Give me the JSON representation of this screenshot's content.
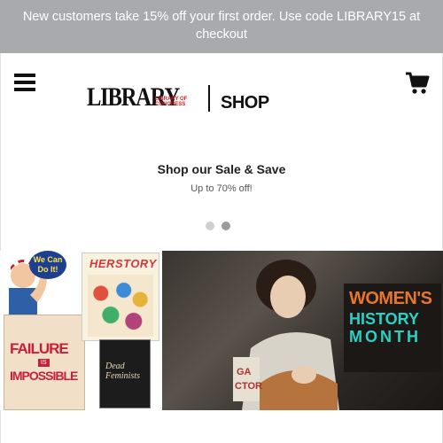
{
  "promo": {
    "text": "New customers take 15% off your first order. Use code LIBRARY15 at checkout"
  },
  "header": {
    "logo_library": "LIBRARY",
    "logo_loc": "LIBRARY OF CONGRESS",
    "logo_shop": "SHOP",
    "menu_icon": "hamburger-menu-icon",
    "cart_icon": "shopping-cart-icon"
  },
  "carousel": {
    "title": "Shop our Sale & Save",
    "subtitle": "Up to 70% off!",
    "slides": 2,
    "active_slide": 2
  },
  "banner": {
    "poster_failure_line1": "FAILURE",
    "poster_failure_line2": "IS",
    "poster_failure_line3": "IMPOSSIBLE",
    "poster_we_can": "We Can Do It!",
    "book_herstory": "HERSTORY",
    "book_feminists": "Dead Feminists",
    "whm_line1": "WOMEN'S",
    "whm_line2": "HISTORY",
    "whm_line3": "MONTH"
  },
  "colors": {
    "promo_bg": "#a9aaad",
    "loc_red": "#d4202a",
    "whm_orange": "#e8762a",
    "whm_teal": "#2bd1c4"
  }
}
